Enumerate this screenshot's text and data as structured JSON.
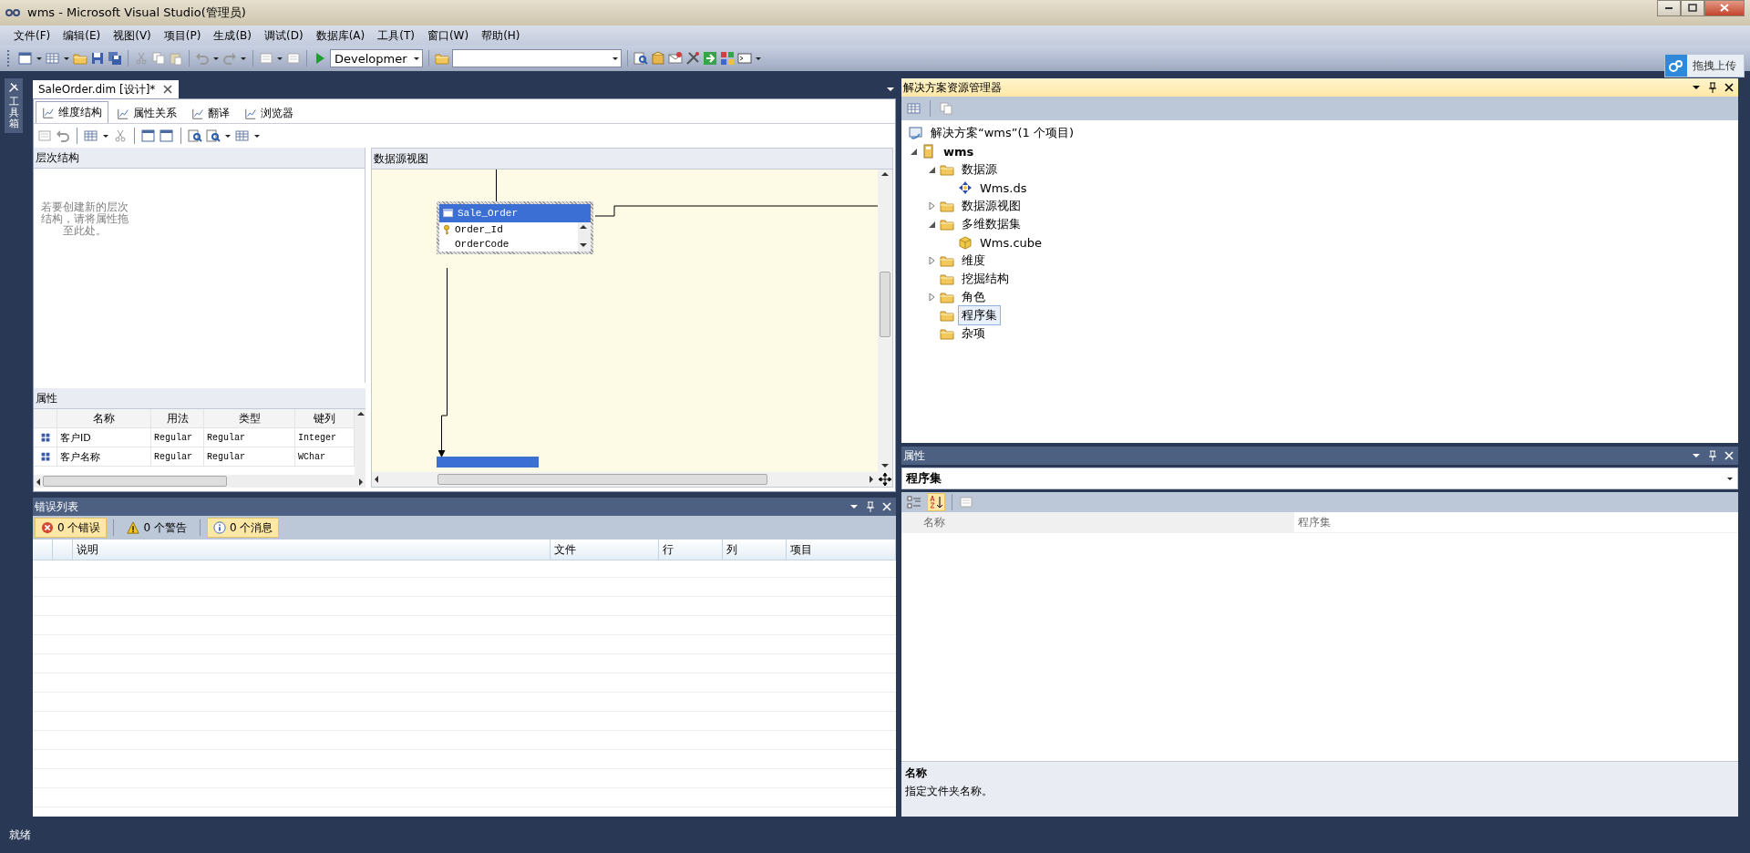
{
  "window": {
    "title": "wms - Microsoft Visual Studio(管理员)"
  },
  "menu": [
    "文件(F)",
    "编辑(E)",
    "视图(V)",
    "项目(P)",
    "生成(B)",
    "调试(D)",
    "数据库(A)",
    "工具(T)",
    "窗口(W)",
    "帮助(H)"
  ],
  "toolbar": {
    "configuration": "Developmer"
  },
  "upload_button": "拖拽上传",
  "toolbox_tab": "工具箱",
  "document_tabs": [
    {
      "label": "SaleOrder.dim [设计]*",
      "selected": true
    }
  ],
  "designer_tabs": [
    {
      "label": "维度结构",
      "selected": true
    },
    {
      "label": "属性关系",
      "selected": false
    },
    {
      "label": "翻译",
      "selected": false
    },
    {
      "label": "浏览器",
      "selected": false
    }
  ],
  "hierarchies": {
    "title": "层次结构",
    "hint": "若要创建新的层次结构，请将属性拖至此处。"
  },
  "attributes": {
    "title": "属性",
    "columns": [
      "名称",
      "用法",
      "类型",
      "键列"
    ],
    "rows": [
      [
        "客户ID",
        "Regular",
        "Regular",
        "Integer"
      ],
      [
        "客户名称",
        "Regular",
        "Regular",
        "WChar"
      ]
    ]
  },
  "data_source_view": {
    "title": "数据源视图",
    "table": {
      "name": "Sale_Order",
      "columns": [
        {
          "name": "Order_Id",
          "key": true
        },
        {
          "name": "OrderCode",
          "key": false
        }
      ]
    }
  },
  "error_list": {
    "title": "错误列表",
    "filters": [
      {
        "label": "0 个错误",
        "kind": "error",
        "selected": true
      },
      {
        "label": "0 个警告",
        "kind": "warning",
        "selected": false
      },
      {
        "label": "0 个消息",
        "kind": "info",
        "selected": true
      }
    ],
    "columns": [
      "说明",
      "文件",
      "行",
      "列",
      "项目"
    ]
  },
  "solution_explorer": {
    "title": "解决方案资源管理器",
    "tree": [
      {
        "label": "解决方案“wms”(1 个项目)",
        "kind": "solution",
        "selected": false,
        "children": [
          {
            "label": "wms",
            "kind": "project",
            "expanded": true,
            "selected": false,
            "children": [
              {
                "label": "数据源",
                "kind": "folder",
                "expanded": true,
                "selected": false,
                "children": [
                  {
                    "label": "Wms.ds",
                    "kind": "datasource",
                    "selected": false
                  }
                ]
              },
              {
                "label": "数据源视图",
                "kind": "folder",
                "expanded": false,
                "selected": false
              },
              {
                "label": "多维数据集",
                "kind": "folder",
                "expanded": true,
                "selected": false,
                "children": [
                  {
                    "label": "Wms.cube",
                    "kind": "cube",
                    "selected": false
                  }
                ]
              },
              {
                "label": "维度",
                "kind": "folder",
                "expanded": false,
                "selected": false
              },
              {
                "label": "挖掘结构",
                "kind": "folder",
                "selected": false
              },
              {
                "label": "角色",
                "kind": "folder",
                "expanded": false,
                "selected": false
              },
              {
                "label": "程序集",
                "kind": "folder",
                "selected": true
              },
              {
                "label": "杂项",
                "kind": "folder",
                "selected": false
              }
            ]
          }
        ]
      }
    ]
  },
  "properties": {
    "title": "属性",
    "object": "程序集",
    "sort_buttons": [
      {
        "kind": "categorized",
        "selected": false
      },
      {
        "kind": "alphabetical",
        "selected": true
      }
    ],
    "rows": [
      {
        "name": "名称",
        "value": "程序集"
      }
    ],
    "description": {
      "title": "名称",
      "text": "指定文件夹名称。"
    }
  },
  "status_bar": "就绪"
}
